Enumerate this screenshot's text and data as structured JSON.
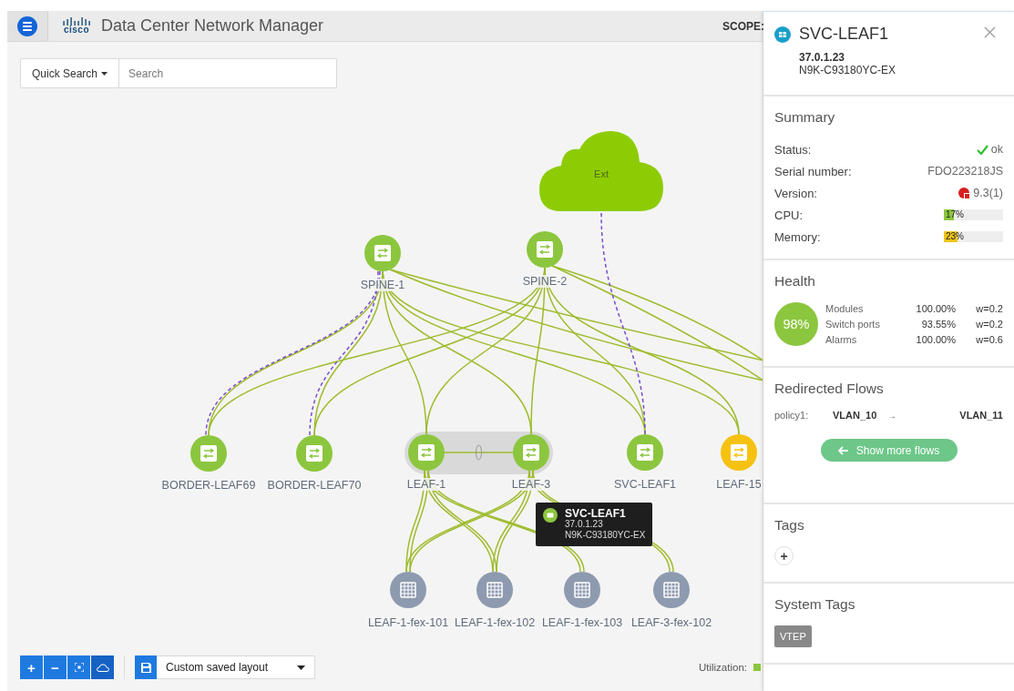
{
  "header": {
    "logo_text": "cisco",
    "title": "Data Center Network Manager",
    "scope_label": "SCOPE:"
  },
  "quick_search": {
    "button": "Quick Search",
    "placeholder": "Search"
  },
  "topology": {
    "nodes": [
      {
        "kind": "cloud",
        "label": "Ext",
        "color": "#8dcc05"
      },
      {
        "kind": "switch",
        "label": "SPINE-1",
        "color": "#8cc63f"
      },
      {
        "kind": "switch",
        "label": "SPINE-2",
        "color": "#8cc63f"
      },
      {
        "kind": "switch",
        "label": "BORDER-LEAF69",
        "color": "#8cc63f"
      },
      {
        "kind": "switch",
        "label": "BORDER-LEAF70",
        "color": "#8cc63f"
      },
      {
        "kind": "switch",
        "label": "LEAF-1",
        "color": "#8cc63f"
      },
      {
        "kind": "switch",
        "label": "LEAF-3",
        "color": "#8cc63f"
      },
      {
        "kind": "switch",
        "label": "SVC-LEAF1",
        "color": "#8cc63f"
      },
      {
        "kind": "switch",
        "label": "LEAF-15",
        "color": "#f5c211"
      },
      {
        "kind": "fex",
        "label": "LEAF-1-fex-101",
        "color": "#8e9aaf"
      },
      {
        "kind": "fex",
        "label": "LEAF-1-fex-102",
        "color": "#8e9aaf"
      },
      {
        "kind": "fex",
        "label": "LEAF-1-fex-103",
        "color": "#8e9aaf"
      },
      {
        "kind": "fex",
        "label": "LEAF-3-fex-102",
        "color": "#8e9aaf"
      }
    ],
    "tooltip": {
      "title": "SVC-LEAF1",
      "ip": "37.0.1.23",
      "model": "N9K-C93180YC-EX"
    }
  },
  "toolbar": {
    "buttons": [
      {
        "kind": "zoom-in",
        "label": "+",
        "selected": false
      },
      {
        "kind": "zoom-out",
        "label": "−",
        "selected": false
      },
      {
        "kind": "fit",
        "selected": false
      },
      {
        "kind": "cloud",
        "selected": true
      }
    ],
    "layout": "Custom saved layout",
    "utilization_label": "Utilization:"
  },
  "details": {
    "title": "SVC-LEAF1",
    "ip": "37.0.1.23",
    "model": "N9K-C93180YC-EX"
  },
  "summary": {
    "heading": "Summary",
    "rows": [
      {
        "kind": "status",
        "label": "Status:",
        "value": "ok"
      },
      {
        "kind": "text",
        "label": "Serial number:",
        "value": "FDO223218JS"
      },
      {
        "kind": "version",
        "label": "Version:",
        "value": "9.3(1)"
      },
      {
        "kind": "meter",
        "label": "CPU:",
        "value": "17%",
        "level": 0.17,
        "color": "#8cc63f"
      },
      {
        "kind": "meter",
        "label": "Memory:",
        "value": "23%",
        "level": 0.23,
        "color": "#f0c419"
      }
    ]
  },
  "health": {
    "heading": "Health",
    "score": "98%",
    "rows": [
      {
        "name": "Modules",
        "percent": "100.00%",
        "weight": "w=0.2"
      },
      {
        "name": "Switch ports",
        "percent": "93.55%",
        "weight": "w=0.2"
      },
      {
        "name": "Alarms",
        "percent": "100.00%",
        "weight": "w=0.6"
      }
    ]
  },
  "redirected_flows": {
    "heading": "Redirected Flows",
    "flows": [
      {
        "policy": "policy1:",
        "from": "VLAN_10",
        "arrow": "→",
        "to": "VLAN_11"
      }
    ],
    "button": "Show more flows"
  },
  "tags": {
    "heading": "Tags",
    "add": "+"
  },
  "system_tags": {
    "heading": "System Tags",
    "tags": [
      "VTEP"
    ]
  }
}
